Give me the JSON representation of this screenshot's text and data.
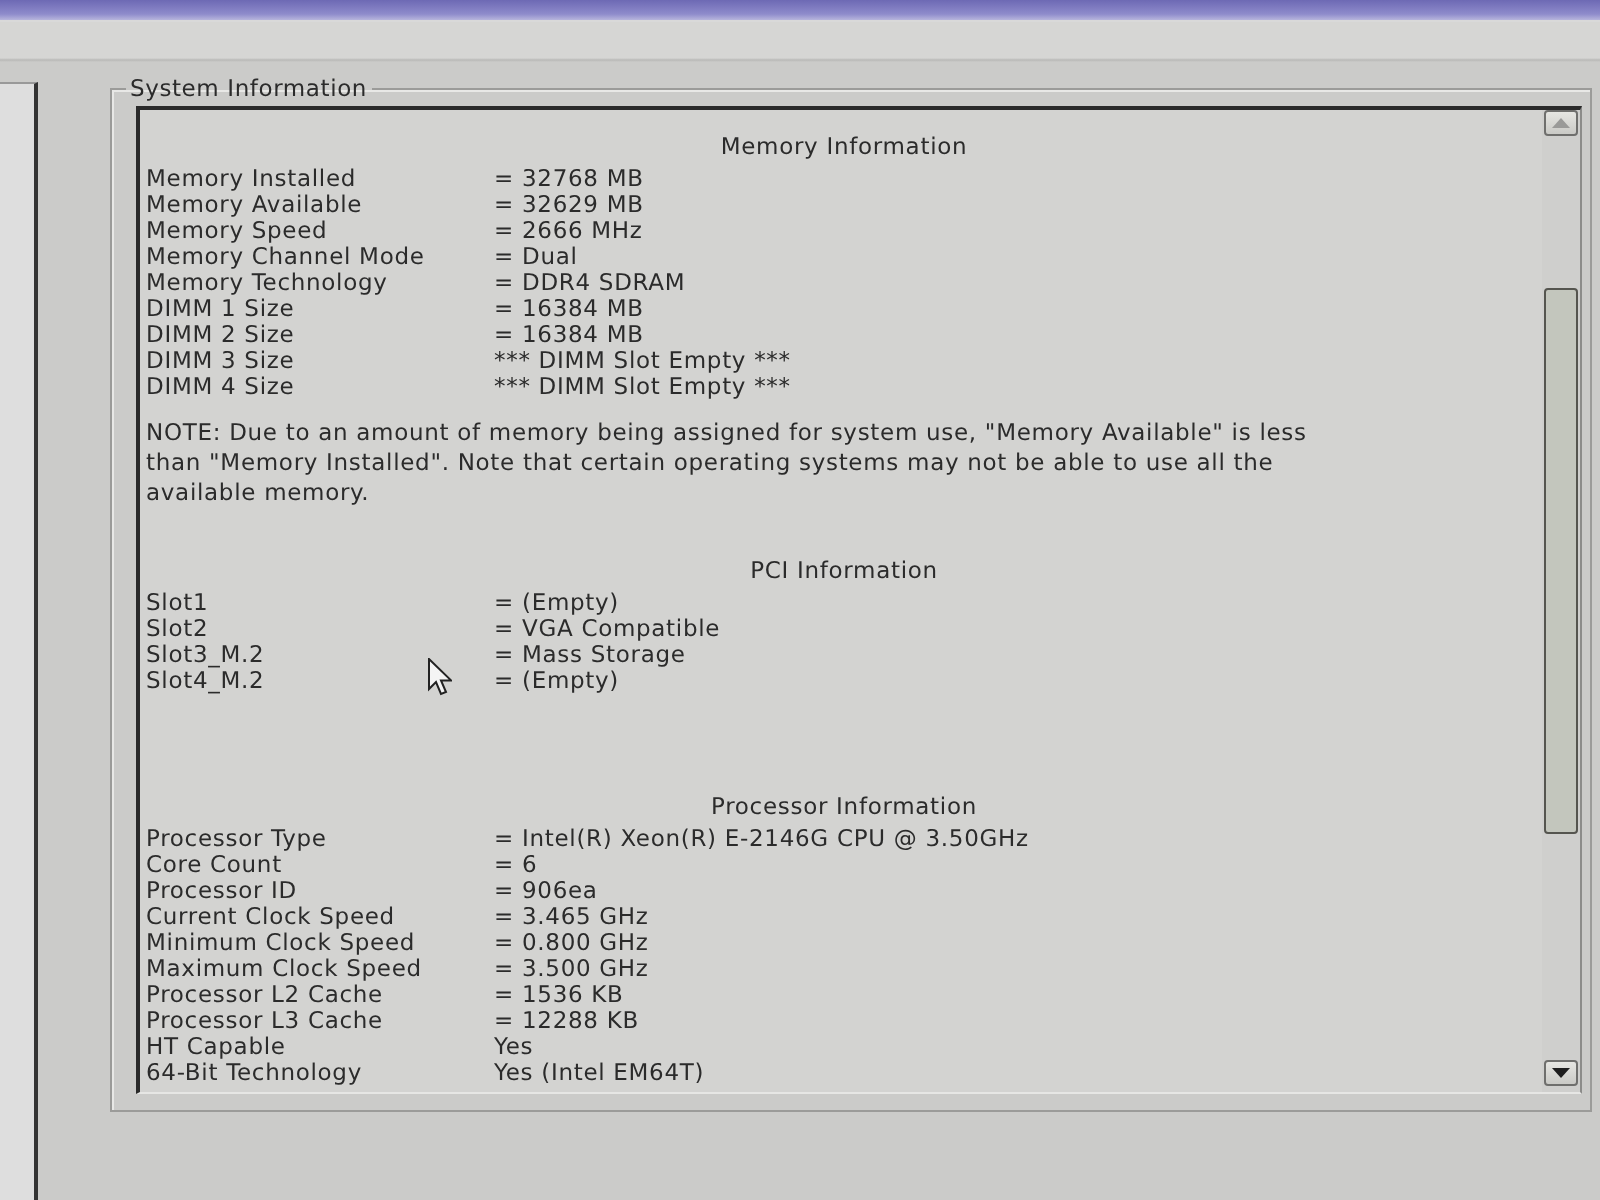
{
  "group": {
    "title": "System Information"
  },
  "sections": [
    {
      "heading": "Memory Information",
      "rows": [
        {
          "label": "Memory Installed",
          "value": "= 32768 MB"
        },
        {
          "label": "Memory Available",
          "value": "= 32629 MB"
        },
        {
          "label": "Memory Speed",
          "value": "= 2666 MHz"
        },
        {
          "label": "Memory Channel Mode",
          "value": "= Dual"
        },
        {
          "label": "Memory Technology",
          "value": "= DDR4 SDRAM"
        },
        {
          "label": "DIMM 1 Size",
          "value": "= 16384 MB"
        },
        {
          "label": "DIMM 2 Size",
          "value": "= 16384 MB"
        },
        {
          "label": "DIMM 3 Size",
          "value": "*** DIMM Slot Empty ***"
        },
        {
          "label": "DIMM 4 Size",
          "value": "*** DIMM Slot Empty ***"
        }
      ],
      "note": "NOTE: Due to an amount of memory being assigned for system use, \"Memory Available\" is less than \"Memory Installed\". Note that certain operating systems may not be able to use all the available memory."
    },
    {
      "heading": "PCI Information",
      "rows": [
        {
          "label": "Slot1",
          "value": "= (Empty)"
        },
        {
          "label": "Slot2",
          "value": "= VGA Compatible"
        },
        {
          "label": "Slot3_M.2",
          "value": "= Mass Storage"
        },
        {
          "label": "Slot4_M.2",
          "value": "= (Empty)"
        }
      ]
    },
    {
      "heading": "Processor Information",
      "rows": [
        {
          "label": "Processor Type",
          "value": "= Intel(R) Xeon(R) E-2146G CPU @ 3.50GHz"
        },
        {
          "label": "Core Count",
          "value": "= 6"
        },
        {
          "label": "Processor ID",
          "value": "= 906ea"
        },
        {
          "label": "Current Clock Speed",
          "value": "= 3.465 GHz"
        },
        {
          "label": "Minimum Clock Speed",
          "value": "= 0.800 GHz"
        },
        {
          "label": "Maximum Clock Speed",
          "value": "= 3.500 GHz"
        },
        {
          "label": "Processor L2 Cache",
          "value": "= 1536 KB"
        },
        {
          "label": "Processor L3 Cache",
          "value": "= 12288 KB"
        },
        {
          "label": "HT Capable",
          "value": "Yes"
        },
        {
          "label": "64-Bit Technology",
          "value": "Yes (Intel EM64T)"
        }
      ]
    }
  ]
}
